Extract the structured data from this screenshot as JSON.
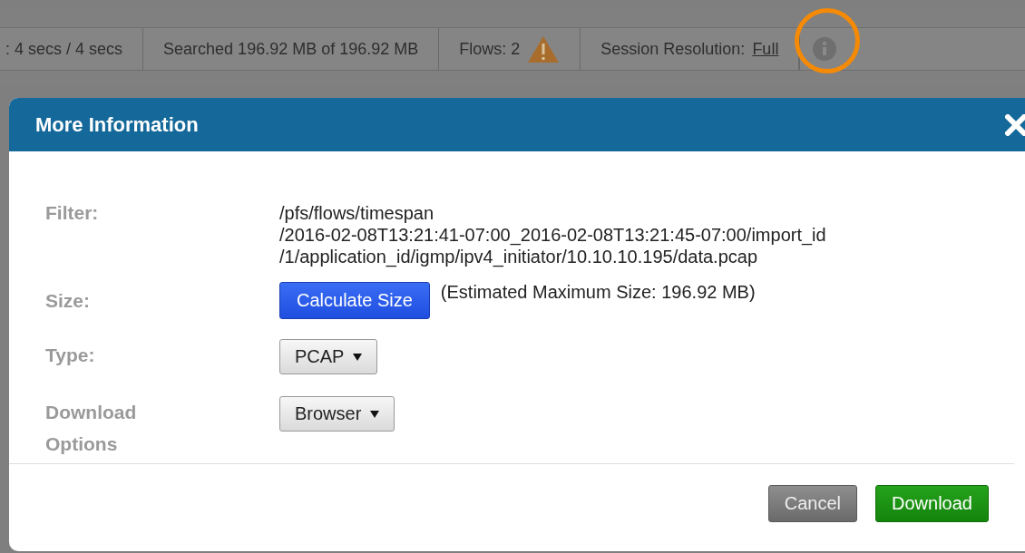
{
  "status_bar": {
    "segments": [
      {
        "kind": "text",
        "text": ": 4 secs / 4 secs"
      },
      {
        "kind": "text",
        "text": "Searched 196.92 MB of 196.92 MB"
      },
      {
        "kind": "warning",
        "text": "Flows: 2"
      },
      {
        "kind": "link",
        "text": "Session Resolution:",
        "link": "Full"
      },
      {
        "kind": "info",
        "highlighted": true
      }
    ]
  },
  "dialog": {
    "title": "More Information",
    "fields": [
      {
        "kind": "text",
        "label": "Filter:",
        "lines": [
          "/pfs/flows/timespan",
          "/2016-02-08T13:21:41-07:00_2016-02-08T13:21:45-07:00/import_id",
          "/1/application_id/igmp/ipv4_initiator/10.10.10.195/data.pcap"
        ]
      },
      {
        "kind": "action",
        "label": "Size:",
        "button": "Calculate Size",
        "note": "(Estimated Maximum Size: 196.92 MB)"
      },
      {
        "kind": "dropdown",
        "label": "Type:",
        "value": "PCAP"
      },
      {
        "kind": "dropdown",
        "label": "Download Options",
        "value": "Browser"
      }
    ],
    "buttons": [
      {
        "kind": "secondary",
        "label": "Cancel"
      },
      {
        "kind": "primary",
        "label": "Download"
      }
    ]
  }
}
